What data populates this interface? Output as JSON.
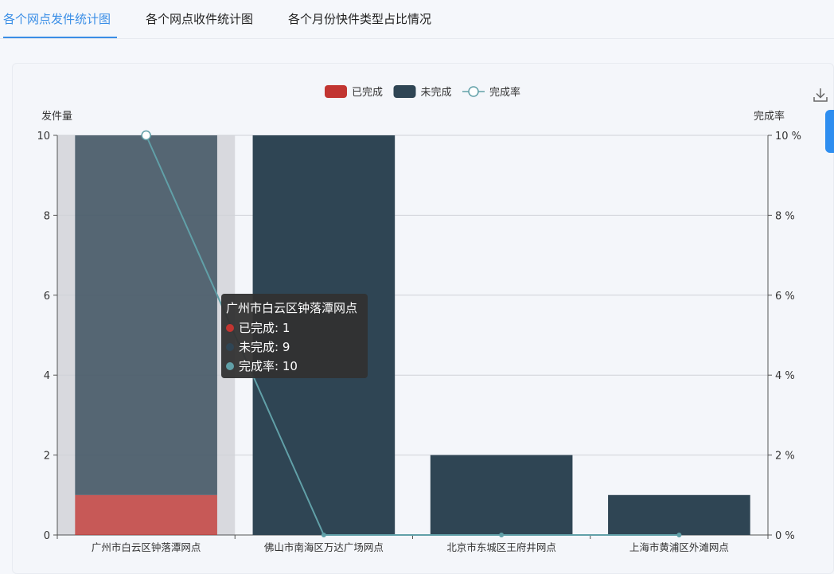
{
  "tabs": [
    {
      "label": "各个网点发件统计图",
      "active": true
    },
    {
      "label": "各个网点收件统计图",
      "active": false
    },
    {
      "label": "各个月份快件类型占比情况",
      "active": false
    }
  ],
  "toolbox": {
    "download_icon": "download-icon"
  },
  "tooltip": {
    "title": "广州市白云区钟落潭网点",
    "rows": [
      {
        "label": "已完成: 1",
        "color": "#c23531"
      },
      {
        "label": "未完成: 9",
        "color": "#2f4554"
      },
      {
        "label": "完成率: 10",
        "color": "#61a0a8"
      }
    ]
  },
  "chart_data": {
    "type": "bar",
    "stacked": true,
    "categories": [
      "广州市白云区钟落潭网点",
      "佛山市南海区万达广场网点",
      "北京市东城区王府井网点",
      "上海市黄浦区外滩网点"
    ],
    "series": [
      {
        "name": "已完成",
        "type": "bar",
        "color": "#c23531",
        "values": [
          1,
          0,
          0,
          0
        ]
      },
      {
        "name": "未完成",
        "type": "bar",
        "color": "#2f4554",
        "values": [
          9,
          10,
          2,
          1
        ]
      },
      {
        "name": "完成率",
        "type": "line",
        "color": "#61a0a8",
        "axis": "right",
        "values": [
          10,
          0,
          0,
          0
        ]
      }
    ],
    "ylabel": "发件量",
    "ylabel_right": "完成率",
    "ylim": [
      0,
      10
    ],
    "yticks": [
      0,
      2,
      4,
      6,
      8,
      10
    ],
    "ylim_right": [
      0,
      10
    ],
    "yticks_right": [
      "0 %",
      "2 %",
      "4 %",
      "6 %",
      "8 %",
      "10 %"
    ],
    "grid": true,
    "legend": "top-center",
    "highlighted_category": 0
  }
}
